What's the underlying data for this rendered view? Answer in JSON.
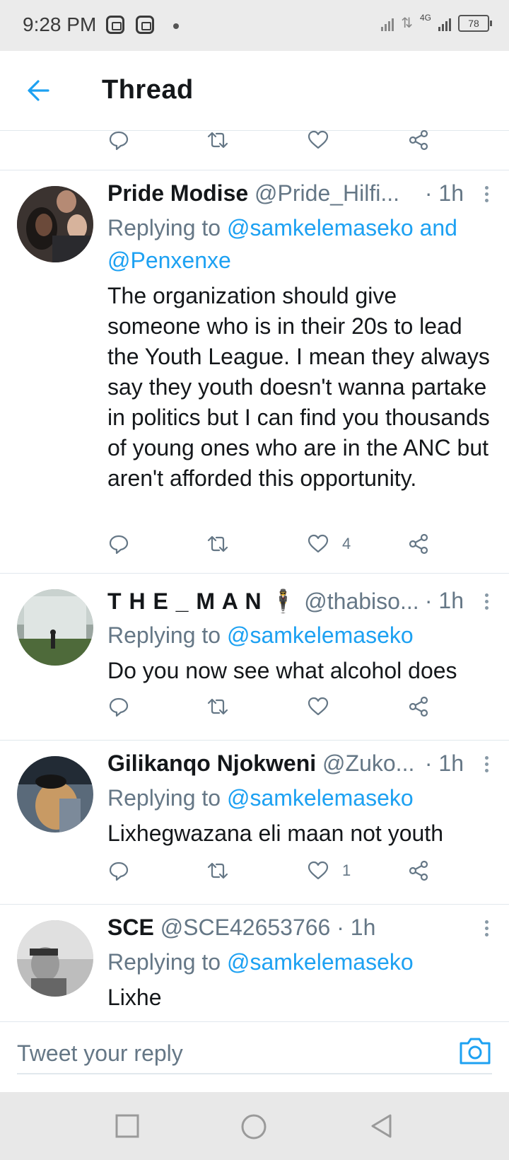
{
  "status_bar": {
    "time": "9:28 PM",
    "battery": "78",
    "network": "4G"
  },
  "header": {
    "title": "Thread"
  },
  "icons": {
    "back": "arrow-left-icon",
    "reply": "reply-icon",
    "retweet": "retweet-icon",
    "like": "heart-icon",
    "share": "share-icon",
    "more": "more-vertical-icon",
    "camera": "camera-icon"
  },
  "colors": {
    "accent": "#1da1f2",
    "secondary_text": "#657786",
    "text": "#14171a"
  },
  "tweets": [
    {
      "name": "Pride Modise",
      "handle": "@Pride_Hilfi...",
      "time": "· 1h",
      "replying_prefix": "Replying to",
      "replying_to": "@samkelemaseko and @Penxenxe",
      "text": "The organization should give someone who is in their 20s to lead the Youth League. I mean they always say they youth doesn't wanna partake in politics but I can find you thousands of young ones who are in the ANC but aren't afforded this opportunity.",
      "likes": "4"
    },
    {
      "name": "T H E _ M A N 🕴",
      "handle": "@thabiso...",
      "time": "· 1h",
      "replying_prefix": "Replying to",
      "replying_to": "@samkelemaseko",
      "text": "Do you now see what alcohol does",
      "likes": ""
    },
    {
      "name": "Gilikanqo Njokweni",
      "handle": "@Zuko...",
      "time": "· 1h",
      "replying_prefix": "Replying to",
      "replying_to": "@samkelemaseko",
      "text": "Lixhegwazana eli maan not youth",
      "likes": "1"
    },
    {
      "name": "SCE",
      "handle": "@SCE42653766",
      "time": "· 1h",
      "replying_prefix": "Replying to",
      "replying_to": "@samkelemaseko",
      "text": "Lixhe",
      "likes": ""
    }
  ],
  "reply_bar": {
    "placeholder": "Tweet your reply"
  }
}
